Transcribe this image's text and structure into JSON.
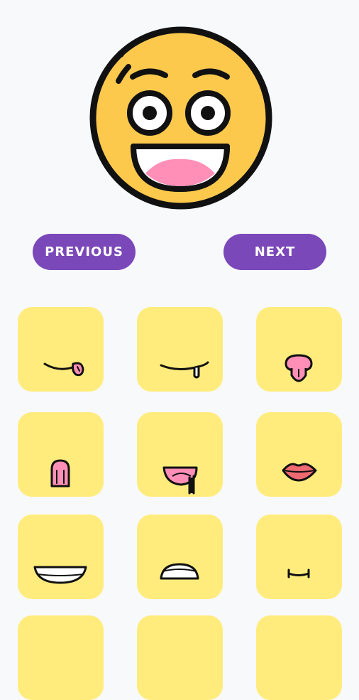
{
  "colors": {
    "background": "#F7F9FB",
    "accent": "#7A48B8",
    "button_text": "#FFFFFF",
    "tile": "#FFEC7D",
    "face": "#FDC94D",
    "tongue": "#FF8FB6",
    "outline": "#111111"
  },
  "preview": {
    "icon": "excited-face-icon"
  },
  "nav": {
    "previous_label": "PREVIOUS",
    "next_label": "NEXT"
  },
  "mouths": [
    {
      "icon": "smirk-tongue-mouth-icon"
    },
    {
      "icon": "drool-mouth-icon"
    },
    {
      "icon": "tongue-out-mouth-icon"
    },
    {
      "icon": "small-open-mouth-icon"
    },
    {
      "icon": "drooling-open-mouth-icon"
    },
    {
      "icon": "lips-icon"
    },
    {
      "icon": "wide-grin-mouth-icon"
    },
    {
      "icon": "teeth-grimace-mouth-icon"
    },
    {
      "icon": "zipped-mouth-icon"
    },
    {
      "icon": "mouth-option-icon"
    },
    {
      "icon": "mouth-option-icon"
    },
    {
      "icon": "mouth-option-icon"
    }
  ]
}
